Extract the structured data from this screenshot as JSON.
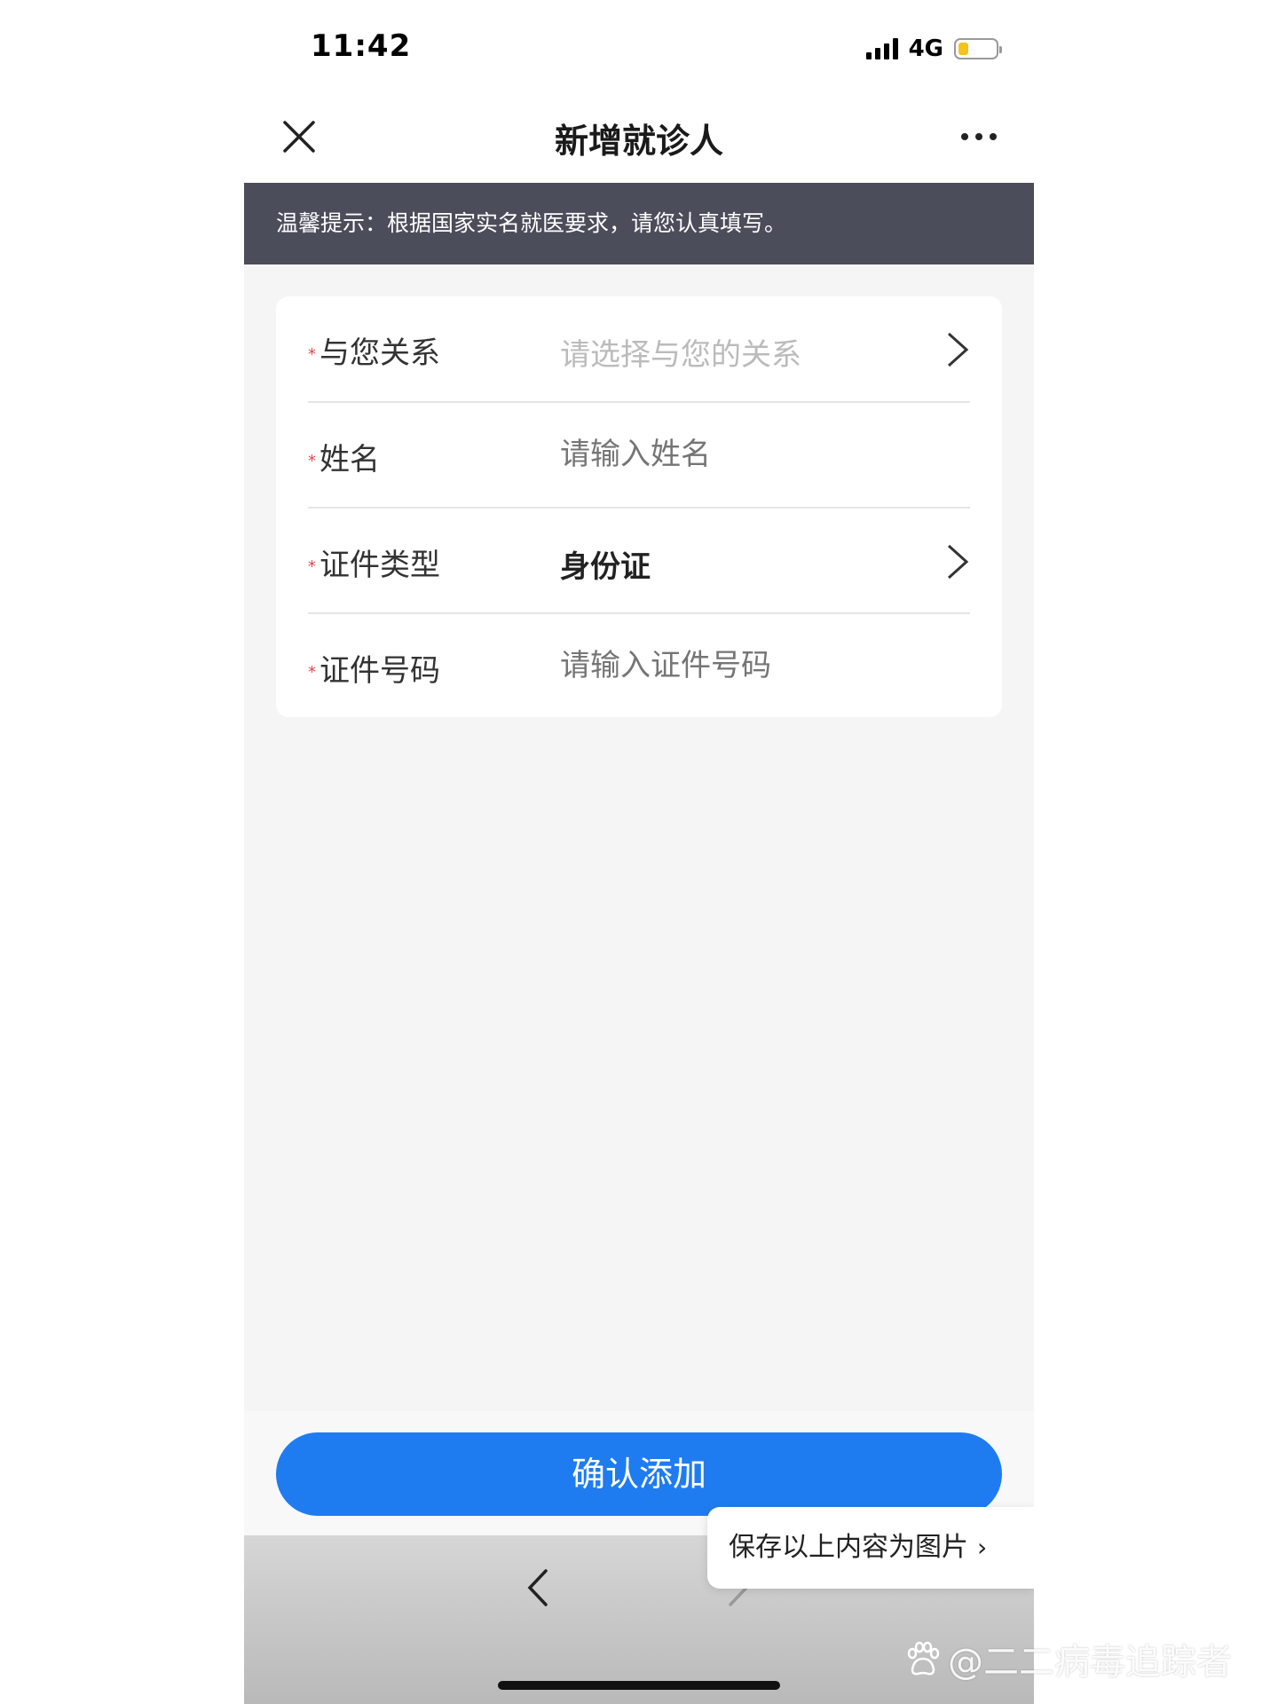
{
  "status_bar": {
    "time": "11:42",
    "network": "4G",
    "battery_color": "#f6c21c"
  },
  "nav": {
    "title": "新增就诊人",
    "close_icon": "close-icon",
    "more_icon": "more-dots-icon"
  },
  "notice": {
    "text": "温馨提示：根据国家实名就医要求，请您认真填写。"
  },
  "form": {
    "rows": [
      {
        "label": "与您关系",
        "placeholder": "请选择与您的关系",
        "value": "",
        "has_chevron": true
      },
      {
        "label": "姓名",
        "placeholder": "请输入姓名",
        "value": "",
        "has_chevron": false
      },
      {
        "label": "证件类型",
        "placeholder": "",
        "value": "身份证",
        "has_chevron": true
      },
      {
        "label": "证件号码",
        "placeholder": "请输入证件号码",
        "value": "",
        "has_chevron": false
      }
    ],
    "required_mark": "*"
  },
  "confirm_button": {
    "label": "确认添加",
    "color": "#1f7cf0"
  },
  "save_popup": {
    "label": "保存以上内容为图片",
    "arrow": "›"
  },
  "watermark": {
    "text": "@二二病毒追踪者"
  }
}
